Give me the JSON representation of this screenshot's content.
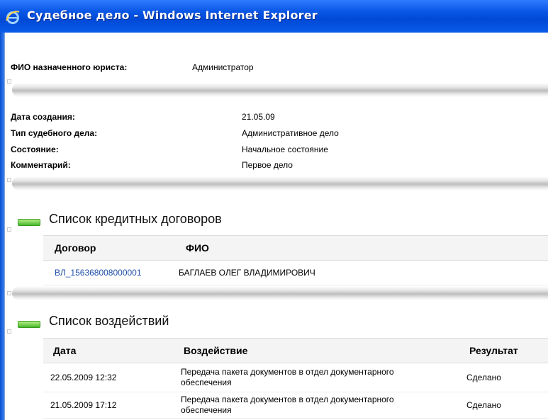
{
  "window": {
    "title": "Судебное дело - Windows Internet Explorer",
    "icon": "ie-icon"
  },
  "lawyer": {
    "label": "ФИО назначенного юриста:",
    "value": "Администратор"
  },
  "details": [
    {
      "label": "Дата создания:",
      "value": "21.05.09"
    },
    {
      "label": "Тип судебного дела:",
      "value": "Административное дело"
    },
    {
      "label": "Состояние:",
      "value": "Начальное состояние"
    },
    {
      "label": "Комментарий:",
      "value": "Первое дело"
    }
  ],
  "contracts": {
    "title": "Список кредитных договоров",
    "columns": [
      "Договор",
      "ФИО"
    ],
    "rows": [
      {
        "contract": "ВЛ_156368008000001",
        "name": "БАГЛАЕВ ОЛЕГ ВЛАДИМИРОВИЧ"
      }
    ]
  },
  "actions": {
    "title": "Список воздействий",
    "columns": [
      "Дата",
      "Воздействие",
      "Результат"
    ],
    "rows": [
      {
        "date": "22.05.2009 12:32",
        "action_line1": "Передача пакета документов в отдел документарного",
        "action_line2": "обеспечения",
        "result": "Сделано"
      },
      {
        "date": "21.05.2009 17:12",
        "action_line1": "Передача пакета документов в отдел документарного",
        "action_line2": "обеспечения",
        "result": "Сделано"
      }
    ]
  },
  "colors": {
    "titlebar": "#0a57e6",
    "link": "#1f4fa8",
    "accent_green": "#46b82a"
  }
}
